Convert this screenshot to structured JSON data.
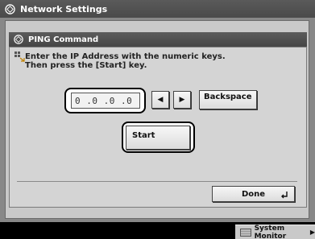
{
  "window": {
    "title": "Network Settings",
    "subtitle": "PING Command"
  },
  "instructions": {
    "line1": "Enter the IP Address with the numeric keys.",
    "line2": "Then press the [Start] key."
  },
  "ip_field": {
    "value": "0 .0 .0 .0"
  },
  "buttons": {
    "left_arrow": "◀",
    "right_arrow": "▶",
    "backspace": "Backspace",
    "start": "Start",
    "done": "Done"
  },
  "status_bar": {
    "system_monitor": "System Monitor"
  },
  "icons": {
    "title": "network-settings-icon",
    "subtitle": "ping-icon",
    "instruction": "keypad-hint-icon",
    "done": "enter-return-icon",
    "system_monitor": "system-monitor-icon"
  }
}
